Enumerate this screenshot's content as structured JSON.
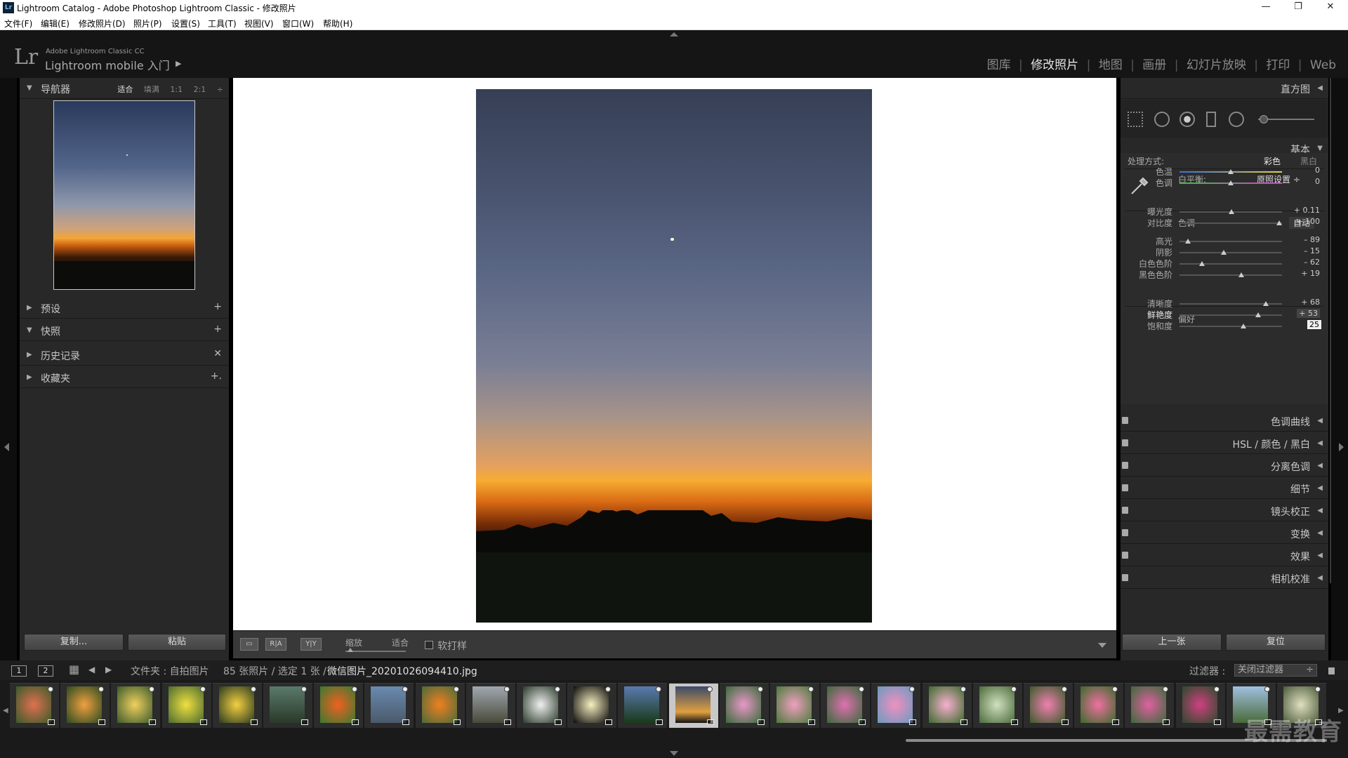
{
  "window": {
    "title": "Lightroom Catalog - Adobe Photoshop Lightroom Classic - 修改照片",
    "icon": "Lr",
    "minimize": "—",
    "restore": "❐",
    "close": "✕"
  },
  "menu": [
    "文件(F)",
    "编辑(E)",
    "修改照片(D)",
    "照片(P)",
    "设置(S)",
    "工具(T)",
    "视图(V)",
    "窗口(W)",
    "帮助(H)"
  ],
  "identity": {
    "logo": "Lr",
    "small": "Adobe Lightroom Classic CC",
    "big": "Lightroom mobile 入门",
    "arrow": "▶"
  },
  "modules": {
    "items": [
      "图库",
      "修改照片",
      "地图",
      "画册",
      "幻灯片放映",
      "打印",
      "Web"
    ],
    "active": 1,
    "separator": "|"
  },
  "left": {
    "navigator": {
      "tri": "▼",
      "label": "导航器",
      "modes": [
        "适合",
        "填满",
        "1:1",
        "2:1"
      ],
      "active_mode": 0,
      "more": "÷"
    },
    "panels": [
      {
        "tri": "▶",
        "label": "预设",
        "action": "+"
      },
      {
        "tri": "▼",
        "label": "快照",
        "action": "+"
      },
      {
        "tri": "▶",
        "label": "历史记录",
        "action": "✕"
      },
      {
        "tri": "▶",
        "label": "收藏夹",
        "action": "+."
      }
    ],
    "buttons": {
      "copy": "复制...",
      "paste": "粘贴"
    }
  },
  "toolbar": {
    "view_icon": "▭",
    "ra_label": "R|A",
    "yy_label": "Y|Y",
    "zoom_label": "缩放",
    "fit_label": "适合",
    "soft_proof": "软打样",
    "dropdown_arrow": "▾"
  },
  "right": {
    "histogram": {
      "label": "直方图",
      "tri": "◀"
    },
    "basic": {
      "label": "基本",
      "tri": "▼",
      "treatment_label": "处理方式:",
      "color": "彩色",
      "bw": "黑白",
      "wb_label": "白平衡:",
      "wb_value": "原照设置 ÷",
      "tone_label": "色调",
      "auto": "自动",
      "presence_label": "偏好",
      "sliders": [
        {
          "label": "色温",
          "value": "0",
          "pos": 0.5
        },
        {
          "label": "色调",
          "value": "0",
          "pos": 0.5
        },
        {
          "label": "曝光度",
          "value": "+ 0.11",
          "pos": 0.51
        },
        {
          "label": "对比度",
          "value": "+ 100",
          "pos": 0.97
        },
        {
          "label": "高光",
          "value": "– 89",
          "pos": 0.08
        },
        {
          "label": "阴影",
          "value": "– 15",
          "pos": 0.43
        },
        {
          "label": "白色色阶",
          "value": "– 62",
          "pos": 0.22
        },
        {
          "label": "黑色色阶",
          "value": "+ 19",
          "pos": 0.6
        },
        {
          "label": "清晰度",
          "value": "+ 68",
          "pos": 0.84
        },
        {
          "label": "鲜艳度",
          "value": "+ 53",
          "pos": 0.77
        },
        {
          "label": "饱和度",
          "value": "25",
          "pos": 0.62
        }
      ]
    },
    "collapsed_panels": [
      {
        "label": "色调曲线"
      },
      {
        "label": "HSL / 颜色 / 黑白"
      },
      {
        "label": "分离色调"
      },
      {
        "label": "细节"
      },
      {
        "label": "镜头校正"
      },
      {
        "label": "变换"
      },
      {
        "label": "效果"
      },
      {
        "label": "相机校准"
      }
    ],
    "collapsed_tri": "◀",
    "buttons": {
      "prev": "上一张",
      "reset": "复位"
    }
  },
  "filmbar": {
    "num1": "1",
    "num2": "2",
    "grid_icon": "▦",
    "back": "◀",
    "forward": "▶",
    "path": "文件夹 : 自拍图片",
    "count": "85 张照片 / 选定 1 张 /",
    "filename": "微信图片_20201026094410.jpg",
    "file_arrow": "▾",
    "filter_label": "过滤器 :",
    "filter_value": "关闭过滤器",
    "filter_arrows": "÷"
  },
  "filmstrip": {
    "selected_index": 13,
    "count": 26
  },
  "watermark": "最需教育"
}
